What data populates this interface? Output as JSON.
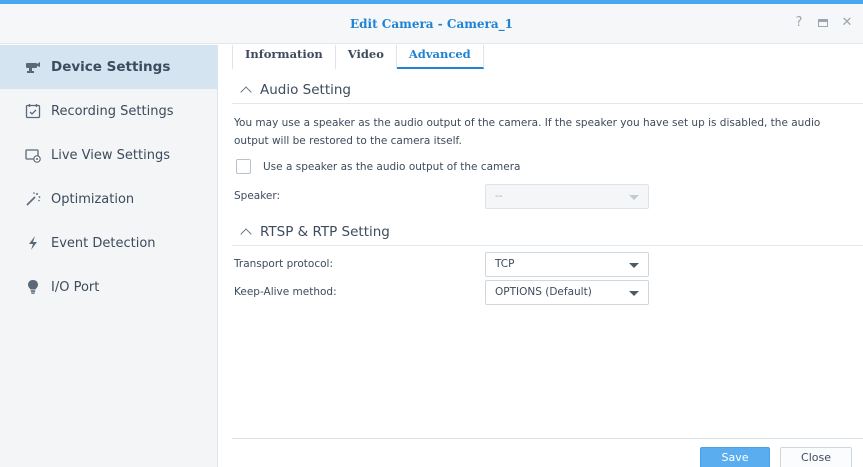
{
  "window": {
    "title": "Edit Camera - Camera_1",
    "controls": {
      "help": "?",
      "maximize": "maximize",
      "close": "✕"
    },
    "accent_color": "#1f82d2"
  },
  "sidebar": {
    "items": [
      {
        "label": "Device Settings",
        "icon": "camera-icon",
        "active": true
      },
      {
        "label": "Recording Settings",
        "icon": "calendar-icon",
        "active": false
      },
      {
        "label": "Live View Settings",
        "icon": "live-view-icon",
        "active": false
      },
      {
        "label": "Optimization",
        "icon": "magic-wand-icon",
        "active": false
      },
      {
        "label": "Event Detection",
        "icon": "lightning-icon",
        "active": false
      },
      {
        "label": "I/O Port",
        "icon": "lightbulb-icon",
        "active": false
      }
    ]
  },
  "tabs": [
    {
      "label": "Information",
      "active": false
    },
    {
      "label": "Video",
      "active": false
    },
    {
      "label": "Advanced",
      "active": true
    }
  ],
  "audio": {
    "heading": "Audio Setting",
    "description": "You may use a speaker as the audio output of the camera. If the speaker you have set up is disabled, the audio output will be restored to the camera itself.",
    "checkbox_label": "Use a speaker as the audio output of the camera",
    "checkbox_checked": false,
    "speaker_label": "Speaker:",
    "speaker_value": "--"
  },
  "rtsp": {
    "heading": "RTSP & RTP Setting",
    "transport_label": "Transport protocol:",
    "transport_value": "TCP",
    "keepalive_label": "Keep-Alive method:",
    "keepalive_value": "OPTIONS (Default)"
  },
  "footer": {
    "save_label": "Save",
    "close_label": "Close"
  }
}
